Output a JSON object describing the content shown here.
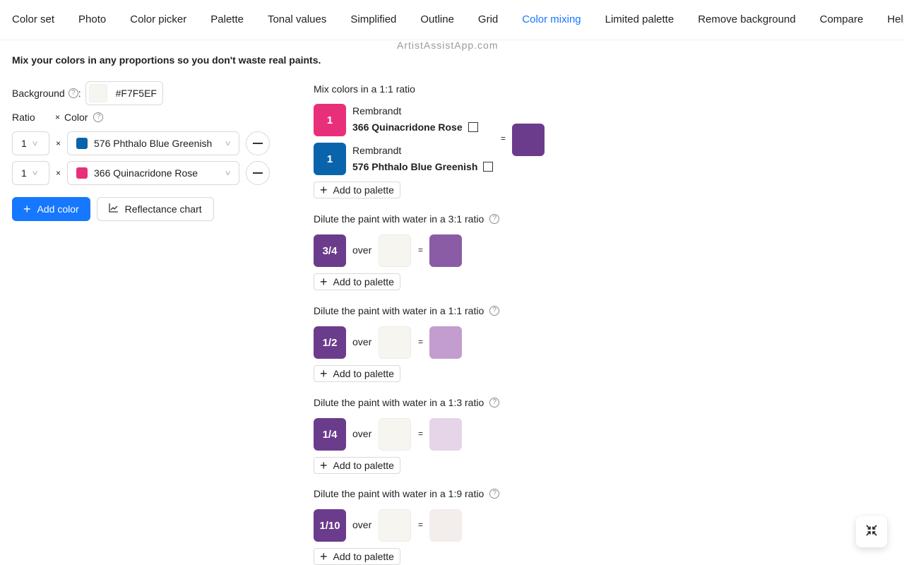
{
  "tabs": [
    {
      "label": "Color set"
    },
    {
      "label": "Photo"
    },
    {
      "label": "Color picker"
    },
    {
      "label": "Palette"
    },
    {
      "label": "Tonal values"
    },
    {
      "label": "Simplified"
    },
    {
      "label": "Outline"
    },
    {
      "label": "Grid"
    },
    {
      "label": "Color mixing",
      "active": true
    },
    {
      "label": "Limited palette"
    },
    {
      "label": "Remove background"
    },
    {
      "label": "Compare"
    },
    {
      "label": "Help"
    }
  ],
  "watermark": "ArtistAssistApp.com",
  "intro": "Mix your colors in any proportions so you don't waste real paints.",
  "background": {
    "label": "Background",
    "colon": ":",
    "value": "#F7F5EF"
  },
  "table_header": {
    "ratio": "Ratio",
    "times": "×",
    "color": "Color"
  },
  "mix_rows": [
    {
      "ratio": "1",
      "times": "×",
      "color_name": "576 Phthalo Blue Greenish",
      "color_hex": "#0A64AC"
    },
    {
      "ratio": "1",
      "times": "×",
      "color_name": "366 Quinacridone Rose",
      "color_hex": "#E8307A"
    }
  ],
  "buttons": {
    "add_color": "Add color",
    "reflectance_chart": "Reflectance chart"
  },
  "mix_result": {
    "title": "Mix colors in a 1:1 ratio",
    "paints": [
      {
        "parts": "1",
        "brand": "Rembrandt",
        "name": "366 Quinacridone Rose",
        "hex": "#E8307A"
      },
      {
        "parts": "1",
        "brand": "Rembrandt",
        "name": "576 Phthalo Blue Greenish",
        "hex": "#0A64AC"
      }
    ],
    "equals": "=",
    "result_hex": "#6B3C8C",
    "add_to_palette": "Add to palette"
  },
  "dilutions": [
    {
      "title": "Dilute the paint with water in a 3:1 ratio",
      "fraction": "3/4",
      "over": "over",
      "equals": "=",
      "result_hex": "#8A5CA6",
      "add_to_palette": "Add to palette"
    },
    {
      "title": "Dilute the paint with water in a 1:1 ratio",
      "fraction": "1/2",
      "over": "over",
      "equals": "=",
      "result_hex": "#C39DCF",
      "add_to_palette": "Add to palette"
    },
    {
      "title": "Dilute the paint with water in a 1:3 ratio",
      "fraction": "1/4",
      "over": "over",
      "equals": "=",
      "result_hex": "#E6D4E8",
      "add_to_palette": "Add to palette"
    },
    {
      "title": "Dilute the paint with water in a 1:9 ratio",
      "fraction": "1/10",
      "over": "over",
      "equals": "=",
      "result_hex": "#F3EDEC",
      "add_to_palette": "Add to palette"
    }
  ],
  "dilution_swatch_hex": "#6B3C8C",
  "fab_icon": "compress-icon"
}
